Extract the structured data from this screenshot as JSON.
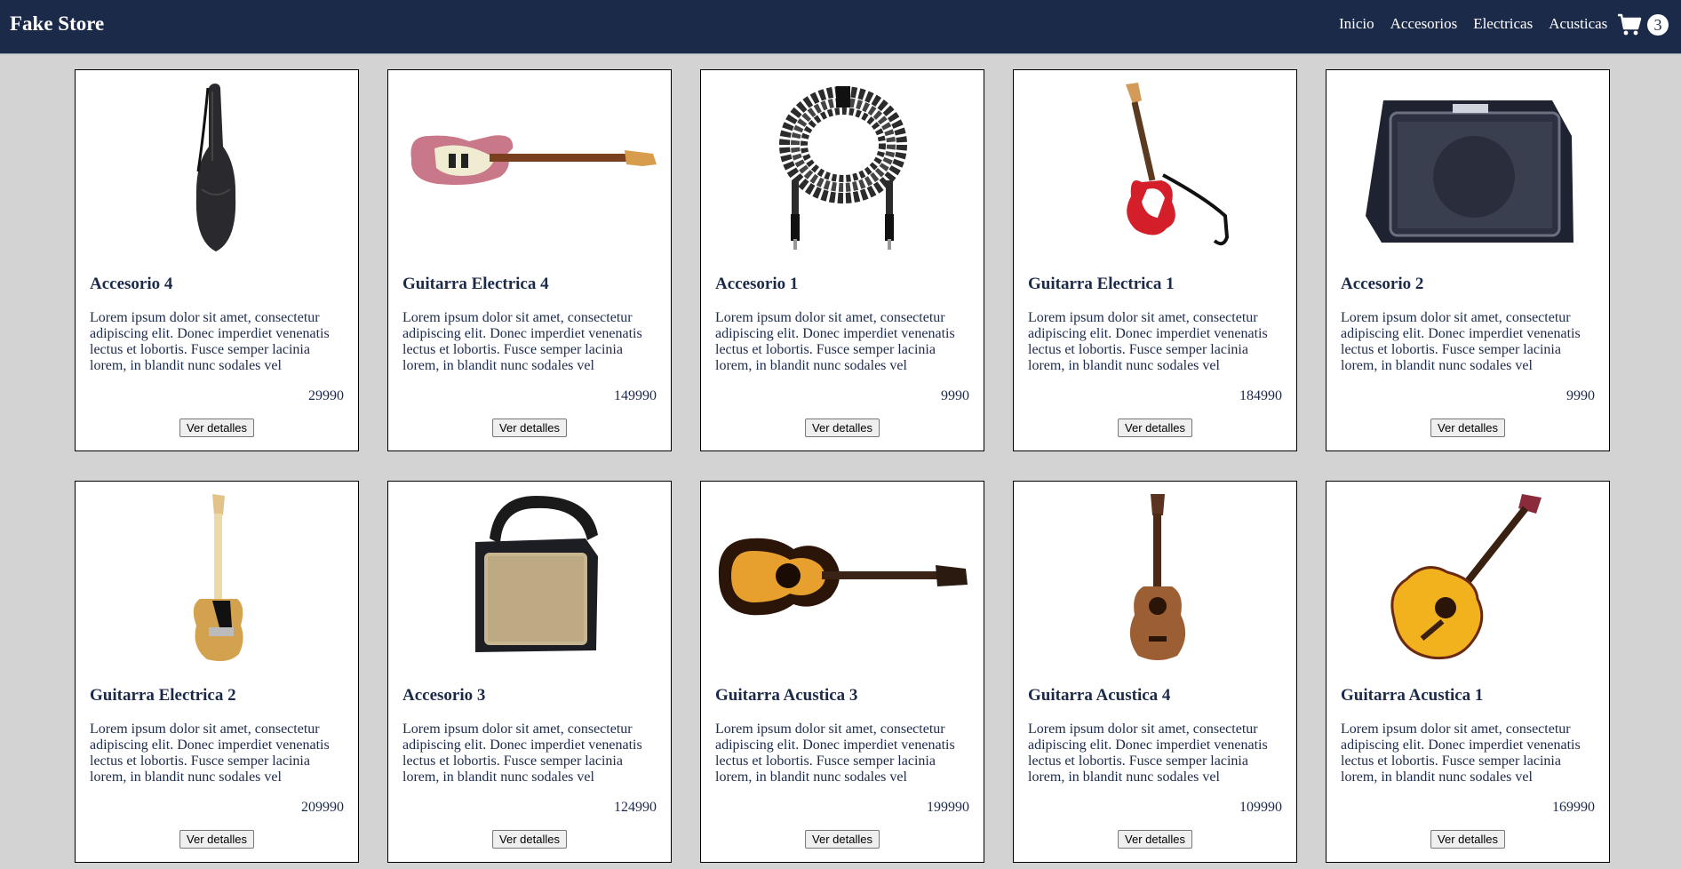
{
  "header": {
    "brand": "Fake Store",
    "nav": [
      {
        "label": "Inicio"
      },
      {
        "label": "Accesorios"
      },
      {
        "label": "Electricas"
      },
      {
        "label": "Acusticas"
      }
    ],
    "cart_icon": "shopping-cart-icon",
    "cart_count": "3"
  },
  "products": [
    {
      "title": "Accesorio 4",
      "image": "guitar-gig-bag-image",
      "description": "Lorem ipsum dolor sit amet, consectetur adipiscing elit. Donec imperdiet venenatis lectus et lobortis. Fusce semper lacinia lorem, in blandit nunc sodales vel",
      "price": "29990",
      "button": "Ver detalles"
    },
    {
      "title": "Guitarra Electrica 4",
      "image": "pink-electric-guitar-image",
      "description": "Lorem ipsum dolor sit amet, consectetur adipiscing elit. Donec imperdiet venenatis lectus et lobortis. Fusce semper lacinia lorem, in blandit nunc sodales vel",
      "price": "149990",
      "button": "Ver detalles"
    },
    {
      "title": "Accesorio 1",
      "image": "guitar-cable-image",
      "description": "Lorem ipsum dolor sit amet, consectetur adipiscing elit. Donec imperdiet venenatis lectus et lobortis. Fusce semper lacinia lorem, in blandit nunc sodales vel",
      "price": "9990",
      "button": "Ver detalles"
    },
    {
      "title": "Guitarra Electrica 1",
      "image": "red-electric-guitar-image",
      "description": "Lorem ipsum dolor sit amet, consectetur adipiscing elit. Donec imperdiet venenatis lectus et lobortis. Fusce semper lacinia lorem, in blandit nunc sodales vel",
      "price": "184990",
      "button": "Ver detalles"
    },
    {
      "title": "Accesorio 2",
      "image": "amplifier-image",
      "description": "Lorem ipsum dolor sit amet, consectetur adipiscing elit. Donec imperdiet venenatis lectus et lobortis. Fusce semper lacinia lorem, in blandit nunc sodales vel",
      "price": "9990",
      "button": "Ver detalles"
    },
    {
      "title": "Guitarra Electrica 2",
      "image": "natural-electric-guitar-image",
      "description": "Lorem ipsum dolor sit amet, consectetur adipiscing elit. Donec imperdiet venenatis lectus et lobortis. Fusce semper lacinia lorem, in blandit nunc sodales vel",
      "price": "209990",
      "button": "Ver detalles"
    },
    {
      "title": "Accesorio 3",
      "image": "small-amplifier-image",
      "description": "Lorem ipsum dolor sit amet, consectetur adipiscing elit. Donec imperdiet venenatis lectus et lobortis. Fusce semper lacinia lorem, in blandit nunc sodales vel",
      "price": "124990",
      "button": "Ver detalles"
    },
    {
      "title": "Guitarra Acustica 3",
      "image": "sunburst-acoustic-guitar-image",
      "description": "Lorem ipsum dolor sit amet, consectetur adipiscing elit. Donec imperdiet venenatis lectus et lobortis. Fusce semper lacinia lorem, in blandit nunc sodales vel",
      "price": "199990",
      "button": "Ver detalles"
    },
    {
      "title": "Guitarra Acustica 4",
      "image": "wood-acoustic-guitar-image",
      "description": "Lorem ipsum dolor sit amet, consectetur adipiscing elit. Donec imperdiet venenatis lectus et lobortis. Fusce semper lacinia lorem, in blandit nunc sodales vel",
      "price": "109990",
      "button": "Ver detalles"
    },
    {
      "title": "Guitarra Acustica 1",
      "image": "yellow-classical-guitar-image",
      "description": "Lorem ipsum dolor sit amet, consectetur adipiscing elit. Donec imperdiet venenatis lectus et lobortis. Fusce semper lacinia lorem, in blandit nunc sodales vel",
      "price": "169990",
      "button": "Ver detalles"
    }
  ]
}
